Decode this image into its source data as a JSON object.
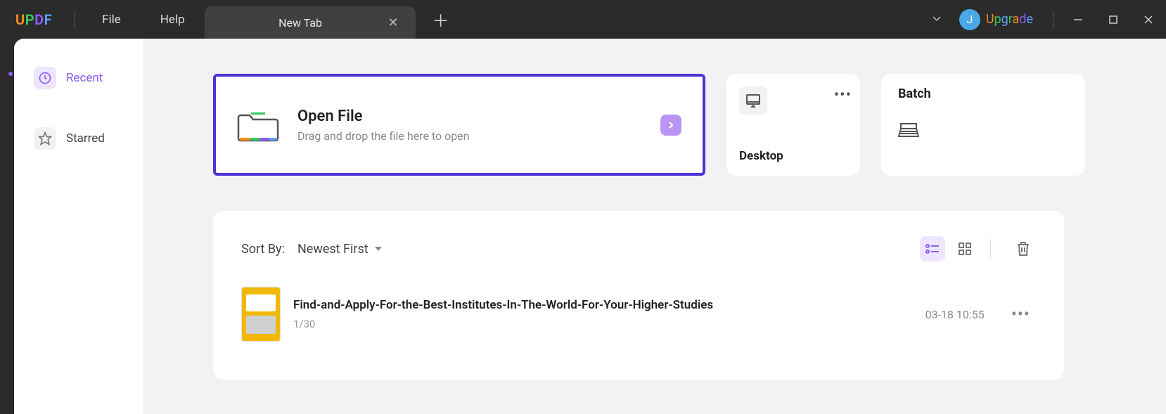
{
  "titlebar": {
    "menu": {
      "file": "File",
      "help": "Help"
    },
    "tab_title": "New Tab",
    "avatar_initial": "J",
    "upgrade": "Upgrade"
  },
  "sidebar": {
    "recent": "Recent",
    "starred": "Starred"
  },
  "open_file": {
    "title": "Open File",
    "subtitle": "Drag and drop the file here to open"
  },
  "desktop_card": {
    "label": "Desktop"
  },
  "batch_card": {
    "label": "Batch"
  },
  "list": {
    "sort_label": "Sort By:",
    "sort_value": "Newest First",
    "files": [
      {
        "name": "Find-and-Apply-For-the-Best-Institutes-In-The-World-For-Your-Higher-Studies",
        "pages": "1/30",
        "date": "03-18 10:55"
      }
    ]
  }
}
